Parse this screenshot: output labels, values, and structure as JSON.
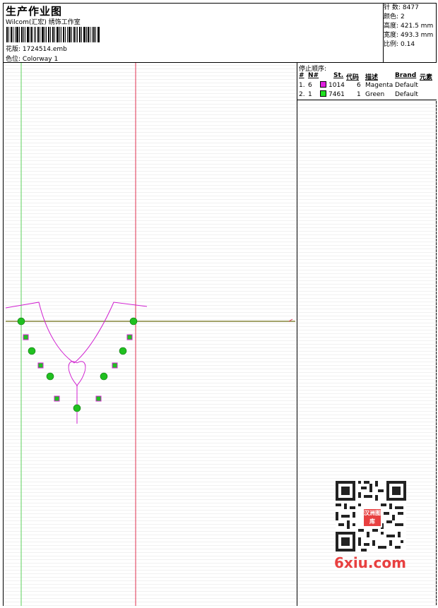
{
  "header": {
    "title": "生产作业图",
    "company": "Wilcom(汇宏) 绣饰工作室",
    "design_label": "花版:",
    "design_file": "1724514.emb",
    "colorway_label": "色位:",
    "colorway": "Colorway 1"
  },
  "stats": [
    {
      "label": "针 数:",
      "value": "8477"
    },
    {
      "label": "颜色:",
      "value": "2"
    },
    {
      "label": "高度:",
      "value": "421.5 mm"
    },
    {
      "label": "宽度:",
      "value": "493.3 mm"
    },
    {
      "label": "比例:",
      "value": "0.14"
    }
  ],
  "stop_sequence": {
    "title": "停止顺序:",
    "columns": [
      "#",
      "N#",
      "St.",
      "代码",
      "描述",
      "Brand",
      "元素"
    ],
    "rows": [
      {
        "index": "1.",
        "needle": "6",
        "code": "1014",
        "stitches": "6",
        "description": "Magenta",
        "brand": "Default",
        "color": "#e020e0"
      },
      {
        "index": "2.",
        "needle": "1",
        "code": "7461",
        "stitches": "1",
        "description": "Green",
        "brand": "Default",
        "color": "#20e020"
      }
    ]
  },
  "guide_colors": {
    "green": "#5ad25a",
    "red": "#e03050",
    "olive": "#6b6b10",
    "magenta": "#d020d0",
    "marker": "#20c020"
  },
  "watermark": {
    "brand": "6xiu.com",
    "badge": "汉洲图库"
  }
}
